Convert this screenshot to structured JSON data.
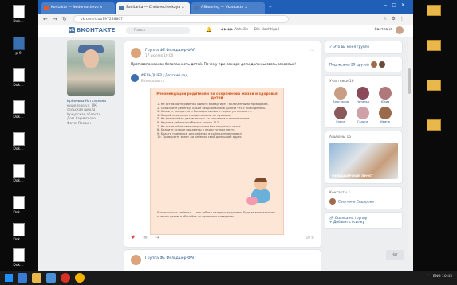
{
  "desktop": {
    "left_icons": [
      {
        "label": "Dok…",
        "type": "doc"
      },
      {
        "label": "p-9",
        "type": "app"
      },
      {
        "label": "Dok…",
        "type": "doc"
      },
      {
        "label": "Dok…",
        "type": "doc"
      },
      {
        "label": "Dok…",
        "type": "doc"
      },
      {
        "label": "Dok…",
        "type": "doc"
      },
      {
        "label": "Dok…",
        "type": "doc"
      },
      {
        "label": "Dok…",
        "type": "doc"
      },
      {
        "label": "Dok…",
        "type": "doc"
      }
    ],
    "right_icons": [
      {
        "label": "",
        "type": "folder"
      },
      {
        "label": "",
        "type": "folder"
      },
      {
        "label": "",
        "type": "folder"
      },
      {
        "label": "",
        "type": "folder"
      }
    ]
  },
  "browser": {
    "tabs": [
      {
        "label": "Kontakte — Nedomoshevo ×"
      },
      {
        "label": "Sanitarka — Chelovecheskaya ×"
      },
      {
        "label": "ASbooring — Vkontakte ×"
      }
    ],
    "url": "vk.com/club197288807"
  },
  "vk": {
    "logo": "ВКОНТАКТЕ",
    "search_placeholder": "Поиск",
    "player": "Abteilin — Die Nachtigall",
    "user_name": "Светлана"
  },
  "left": {
    "lines": [
      "Ирбиевна Натальевна",
      "кушелево ул. ПК",
      "сельская школа",
      "Иркутская область",
      "Дом Харибского",
      "Фото: Яоовин"
    ]
  },
  "post": {
    "author": "Группа ФЕ Фельдшер-ФАП",
    "date": "17 июля в 10:00",
    "text": "Противопожарная безопасность детей. Почему при пожаре дети должны звать взрослых!",
    "repost_author": "ФЕЛЬДШЕР | Детский сад",
    "repost_sub": "Безопасность",
    "poster_title": "Рекомендации родителям по сохранению жизни и здоровья детей",
    "poster_lines": [
      "1. Не оставляйте ребенка одного в квартире с включенными приборами.",
      "2. Объясните ребенку, какие вещи опасны в доме и что с ними делать.",
      "3. Храните лекарства и бытовую химию в недоступном месте.",
      "4. Закройте розетки специальными заглушками.",
      "5. Не разрешайте детям играть со спичками и зажигалками.",
      "6. Научите ребенка набирать номер 112.",
      "7. Не оставляйте окна открытыми без защитных сеток.",
      "8. Храните острые предметы в недоступном месте.",
      "9. Будьте примером для ребенка в соблюдении правил.",
      "10. Проверьте, знает ли ребенок свой домашний адрес."
    ],
    "poster_bottom": "Безопасность ребенка — это забота каждого родителя. Будьте внимательны к своим детям и обучайте их правилам поведения.",
    "views": "10 ©"
  },
  "post2": {
    "author": "Группа ФЕ Фельдшер-ФАП"
  },
  "right": {
    "box1": "Это вы меня группе",
    "box2_label": "Подписаны 29 друзей",
    "friends_header": "Участники 16",
    "friends": [
      "Анастасия",
      "Наталья",
      "Юлия",
      "Елена",
      "Галина",
      "Ирина"
    ],
    "album_header": "Альбомы 16",
    "album_caption": "ФЕЛЬДШЕРСКИЙ ПУНКТ",
    "contacts_header": "Контакты 1",
    "contact_name": "Светлана Сидорова",
    "bottom_link": "Ссылка на группу",
    "discuss": "Добавить ссылку"
  },
  "chat": "Чат",
  "tray": "^ ⋅ ENG 10:45"
}
